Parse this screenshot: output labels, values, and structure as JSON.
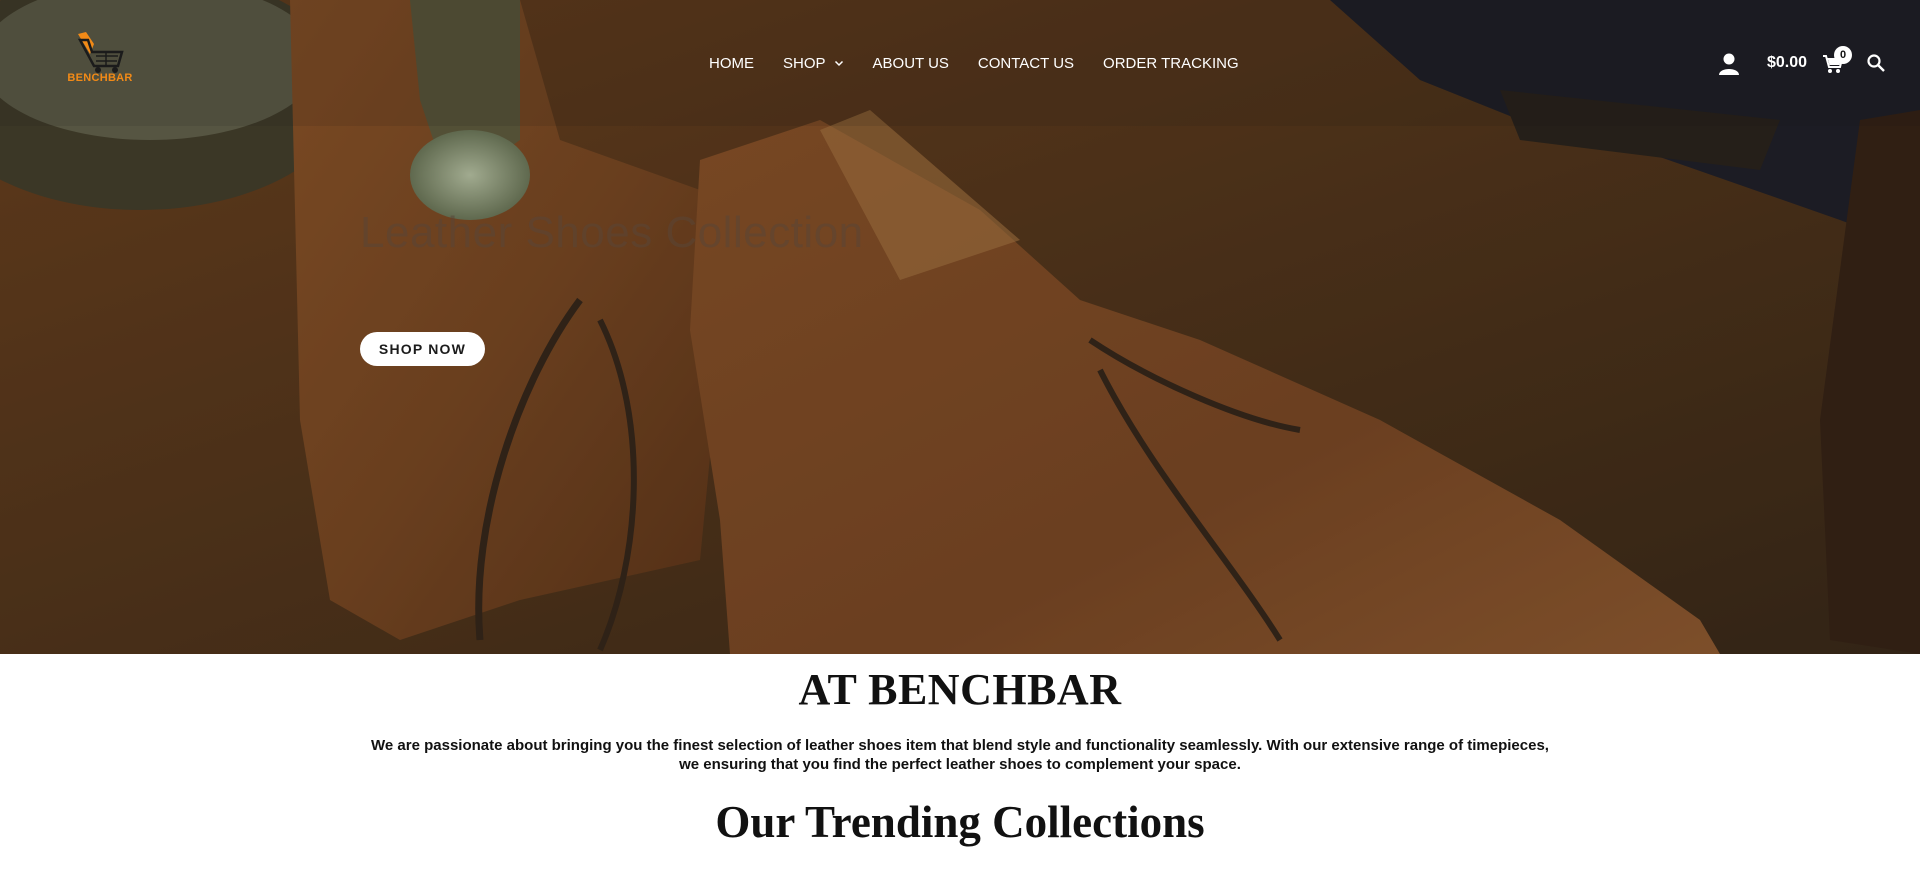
{
  "brand": {
    "logo_text": "BENCHBAR",
    "logo_color": "#f28a17"
  },
  "nav": {
    "items": [
      {
        "label": "HOME"
      },
      {
        "label": "SHOP",
        "has_dropdown": true
      },
      {
        "label": "ABOUT US"
      },
      {
        "label": "CONTACT US"
      },
      {
        "label": "ORDER TRACKING"
      }
    ]
  },
  "header_actions": {
    "account_icon": "user-icon",
    "cart_total": "$0.00",
    "cart_icon": "cart-icon",
    "cart_count": "0",
    "search_icon": "search-icon"
  },
  "hero": {
    "title": "Leather Shoes Collection",
    "cta_label": "SHOP NOW"
  },
  "about": {
    "title": "AT BENCHBAR",
    "text": "We are passionate about bringing you the finest selection of leather shoes item that blend style and functionality seamlessly. With our extensive range of timepieces, we ensuring that you find the perfect leather shoes to complement your space."
  },
  "trending": {
    "title": "Our Trending Collections"
  }
}
